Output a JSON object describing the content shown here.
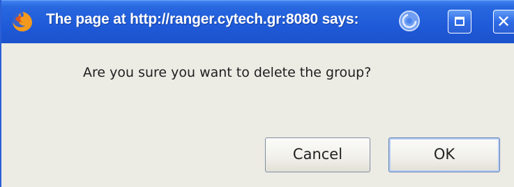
{
  "window": {
    "title": "The page at http://ranger.cytech.gr:8080 says:",
    "app_icon": "firefox-icon",
    "spinner_icon": "loading-spinner-icon",
    "controls": {
      "maximize_icon": "maximize-icon",
      "close_icon": "close-icon",
      "close_glyph": "✕"
    },
    "colors": {
      "titlebar": "#2263DC",
      "body": "#ECEBE4"
    }
  },
  "dialog": {
    "message": "Are you sure you want to delete the group?",
    "cancel_label": "Cancel",
    "ok_label": "OK"
  }
}
